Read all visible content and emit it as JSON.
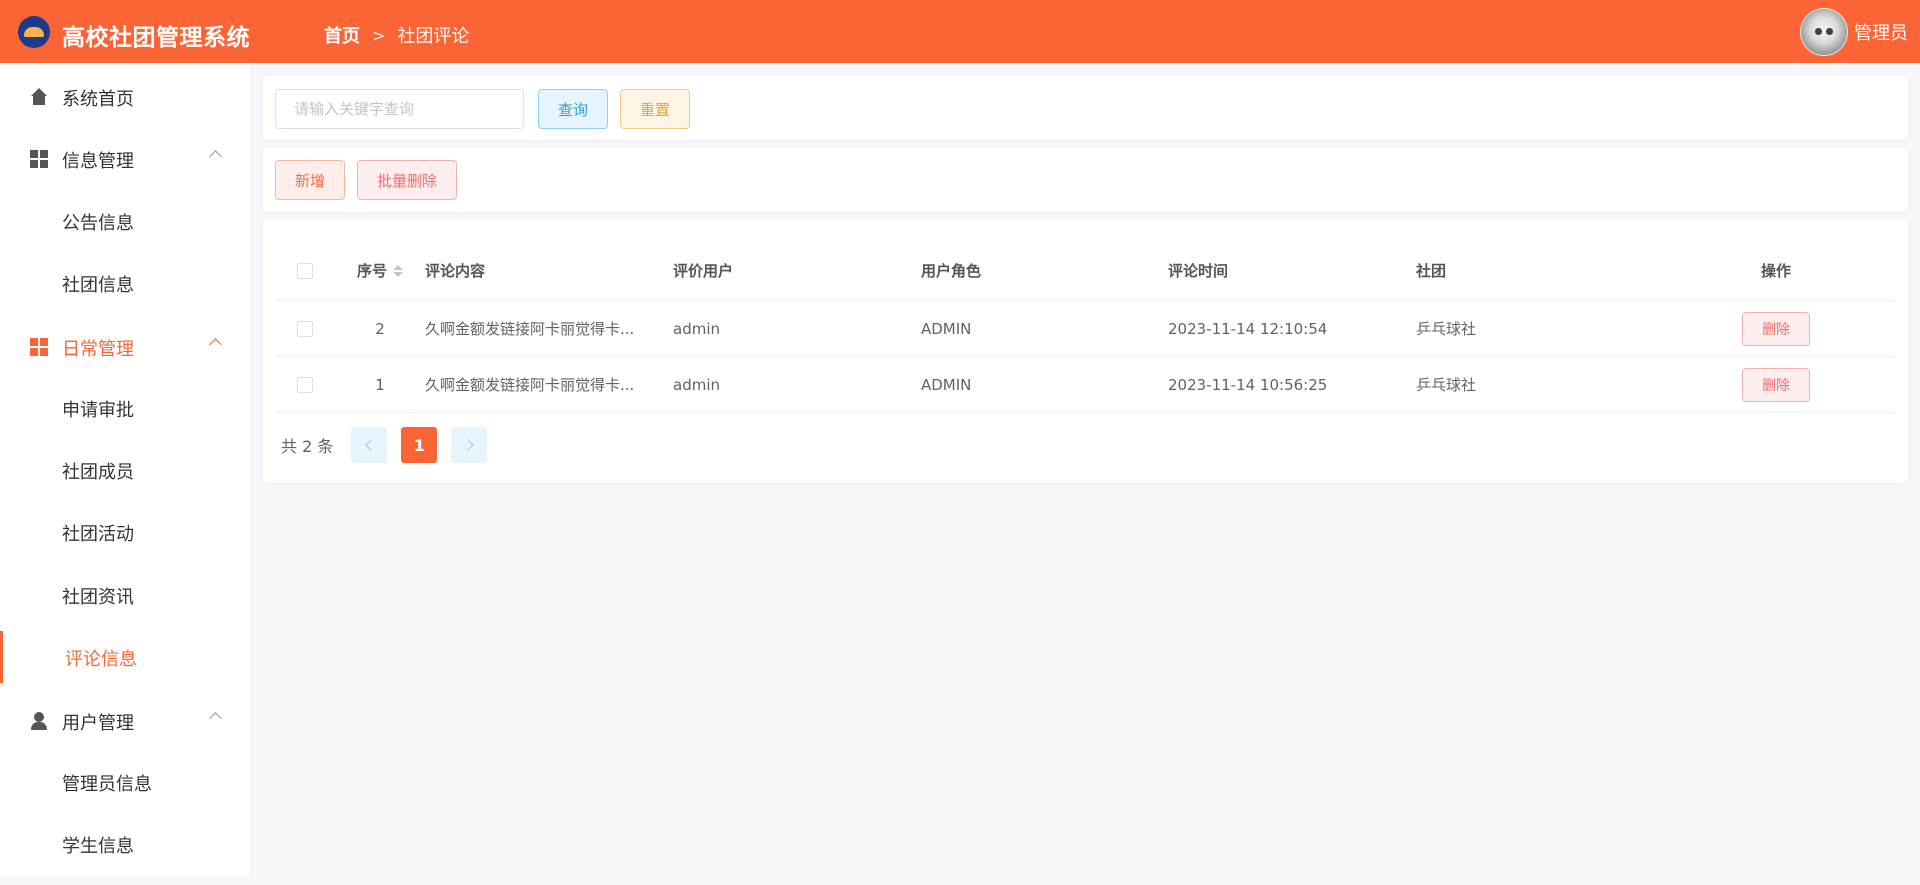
{
  "header": {
    "app_title": "高校社团管理系统",
    "breadcrumb_home": "首页",
    "breadcrumb_current": "社团评论",
    "user_name": "管理员"
  },
  "sidebar": {
    "items": [
      {
        "label": "系统首页",
        "icon": "home-icon"
      },
      {
        "label": "信息管理",
        "icon": "grid-icon",
        "expanded": true,
        "children": [
          "公告信息",
          "社团信息"
        ]
      },
      {
        "label": "日常管理",
        "icon": "grid-icon",
        "expanded": true,
        "active": true,
        "children": [
          "申请审批",
          "社团成员",
          "社团活动",
          "社团资讯",
          "评论信息"
        ]
      },
      {
        "label": "用户管理",
        "icon": "user-icon",
        "expanded": true,
        "children": [
          "管理员信息",
          "学生信息"
        ]
      }
    ],
    "active_item": "评论信息"
  },
  "search": {
    "placeholder": "请输入关键字查询",
    "value": "",
    "query_label": "查询",
    "reset_label": "重置"
  },
  "actions": {
    "add_label": "新增",
    "batch_delete_label": "批量删除"
  },
  "table": {
    "columns": [
      "序号",
      "评论内容",
      "评价用户",
      "用户角色",
      "评论时间",
      "社团",
      "操作"
    ],
    "rows": [
      {
        "idx": "2",
        "content": "久啊金额发链接阿卡丽觉得卡...",
        "user": "admin",
        "role": "ADMIN",
        "time": "2023-11-14 12:10:54",
        "club": "乒乓球社",
        "op": "删除"
      },
      {
        "idx": "1",
        "content": "久啊金额发链接阿卡丽觉得卡...",
        "user": "admin",
        "role": "ADMIN",
        "time": "2023-11-14 10:56:25",
        "club": "乒乓球社",
        "op": "删除"
      }
    ]
  },
  "pagination": {
    "total_text": "共 2 条",
    "current_page": "1"
  },
  "colors": {
    "accent": "#fb6535",
    "background": "#f5f7fb"
  }
}
